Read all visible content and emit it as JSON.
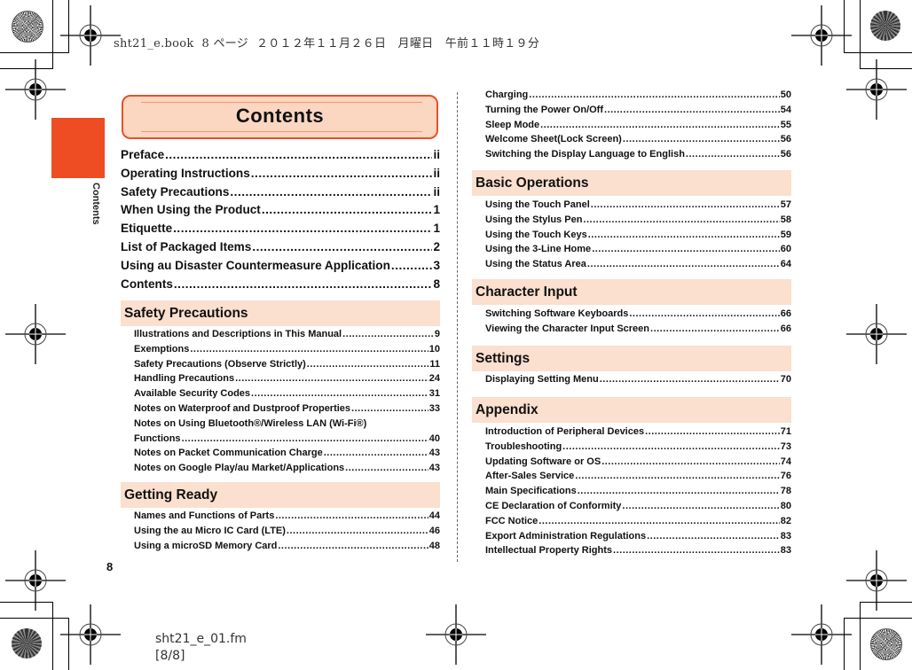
{
  "print_header": "sht21_e.book  8 ページ  ２０１２年１１月２６日　月曜日　午前１１時１９分",
  "print_footer": {
    "file": "sht21_e_01.fm",
    "pages": "[8/8]"
  },
  "side_tab": {
    "label": "Contents",
    "color": "#ee4c22"
  },
  "page_number": "8",
  "title": "Contents",
  "main_entries": [
    {
      "title": "Preface",
      "page": "ii"
    },
    {
      "title": "Operating Instructions",
      "page": "ii"
    },
    {
      "title": "Safety Precautions",
      "page": "ii"
    },
    {
      "title": "When Using the Product",
      "page": "1"
    },
    {
      "title": "Etiquette",
      "page": "1"
    },
    {
      "title": "List of Packaged Items",
      "page": "2"
    },
    {
      "title": "Using au Disaster Countermeasure Application",
      "page": "3"
    },
    {
      "title": "Contents",
      "page": "8"
    }
  ],
  "sections": {
    "safety": {
      "heading": "Safety Precautions",
      "items": [
        {
          "title": "Illustrations and Descriptions in This Manual",
          "page": "9"
        },
        {
          "title": "Exemptions",
          "page": "10"
        },
        {
          "title": "Safety Precautions (Observe Strictly)",
          "page": "11"
        },
        {
          "title": "Handling Precautions",
          "page": "24"
        },
        {
          "title": "Available Security Codes",
          "page": "31"
        },
        {
          "title": "Notes on Waterproof and Dustproof Properties",
          "page": "33"
        },
        {
          "title": "Notes on Using Bluetooth®/Wireless LAN (Wi-Fi®)",
          "page": ""
        },
        {
          "title": "Functions",
          "page": "40"
        },
        {
          "title": "Notes on Packet Communication Charge",
          "page": "43"
        },
        {
          "title": "Notes on Google Play/au Market/Applications",
          "page": "43"
        }
      ]
    },
    "getting_ready": {
      "heading": "Getting Ready",
      "items": [
        {
          "title": "Names and Functions of Parts",
          "page": "44"
        },
        {
          "title": "Using the au Micro IC Card (LTE)",
          "page": "46"
        },
        {
          "title": "Using a microSD Memory Card",
          "page": "48"
        },
        {
          "title": "Charging",
          "page": "50"
        },
        {
          "title": "Turning the Power On/Off",
          "page": "54"
        },
        {
          "title": "Sleep Mode",
          "page": "55"
        },
        {
          "title": "Welcome Sheet(Lock Screen)",
          "page": "56"
        },
        {
          "title": "Switching the Display Language to English",
          "page": "56"
        }
      ]
    },
    "basic": {
      "heading": "Basic Operations",
      "items": [
        {
          "title": "Using the Touch Panel",
          "page": "57"
        },
        {
          "title": "Using the Stylus Pen",
          "page": "58"
        },
        {
          "title": "Using the Touch Keys",
          "page": "59"
        },
        {
          "title": "Using the 3-Line Home",
          "page": "60"
        },
        {
          "title": "Using the Status Area",
          "page": "64"
        }
      ]
    },
    "char_input": {
      "heading": "Character Input",
      "items": [
        {
          "title": "Switching Software Keyboards",
          "page": "66"
        },
        {
          "title": "Viewing the Character Input Screen",
          "page": "66"
        }
      ]
    },
    "settings": {
      "heading": "Settings",
      "items": [
        {
          "title": "Displaying Setting Menu",
          "page": "70"
        }
      ]
    },
    "appendix": {
      "heading": "Appendix",
      "items": [
        {
          "title": "Introduction of Peripheral Devices",
          "page": "71"
        },
        {
          "title": "Troubleshooting",
          "page": "73"
        },
        {
          "title": "Updating Software or OS",
          "page": "74"
        },
        {
          "title": "After-Sales Service",
          "page": "76"
        },
        {
          "title": "Main Specifications",
          "page": "78"
        },
        {
          "title": "CE Declaration of Conformity",
          "page": "80"
        },
        {
          "title": "FCC Notice",
          "page": "82"
        },
        {
          "title": "Export Administration Regulations",
          "page": "83"
        },
        {
          "title": "Intellectual Property Rights",
          "page": "83"
        }
      ]
    }
  }
}
